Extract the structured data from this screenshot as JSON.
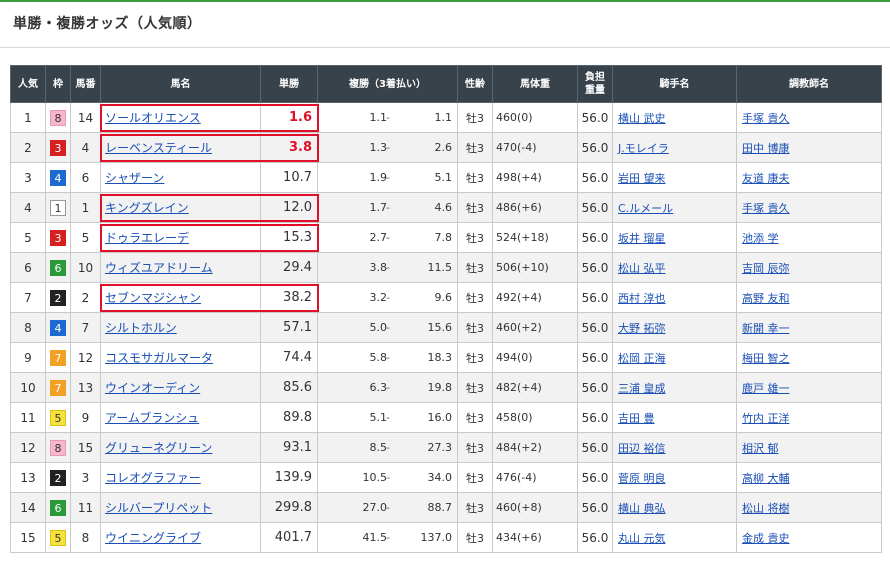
{
  "page": {
    "title": "単勝・複勝オッズ（人気順）"
  },
  "table": {
    "headers": [
      "人気",
      "枠",
      "馬番",
      "馬名",
      "単勝",
      "複勝（3着払い）",
      "性齢",
      "馬体重",
      "負担重量",
      "騎手名",
      "調教師名"
    ],
    "rows": [
      {
        "pop": "1",
        "waku": "8",
        "num": "14",
        "horse": "ソールオリエンス",
        "win": "1.6",
        "plo": "1.1",
        "phi": "1.1",
        "sex": "牡3",
        "weight": "460(0)",
        "kg": "56.0",
        "jockey": "横山 武史",
        "trainer": "手塚 貴久",
        "hot": true
      },
      {
        "pop": "2",
        "waku": "3",
        "num": "4",
        "horse": "レーベンスティール",
        "win": "3.8",
        "plo": "1.3",
        "phi": "2.6",
        "sex": "牡3",
        "weight": "470(-4)",
        "kg": "56.0",
        "jockey": "J.モレイラ",
        "trainer": "田中 博康",
        "hot": true
      },
      {
        "pop": "3",
        "waku": "4",
        "num": "6",
        "horse": "シャザーン",
        "win": "10.7",
        "plo": "1.9",
        "phi": "5.1",
        "sex": "牡3",
        "weight": "498(+4)",
        "kg": "56.0",
        "jockey": "岩田 望来",
        "trainer": "友道 康夫",
        "hot": false
      },
      {
        "pop": "4",
        "waku": "1",
        "num": "1",
        "horse": "キングズレイン",
        "win": "12.0",
        "plo": "1.7",
        "phi": "4.6",
        "sex": "牡3",
        "weight": "486(+6)",
        "kg": "56.0",
        "jockey": "C.ルメール",
        "trainer": "手塚 貴久",
        "hot": false
      },
      {
        "pop": "5",
        "waku": "3",
        "num": "5",
        "horse": "ドゥラエレーデ",
        "win": "15.3",
        "plo": "2.7",
        "phi": "7.8",
        "sex": "牡3",
        "weight": "524(+18)",
        "kg": "56.0",
        "jockey": "坂井 瑠星",
        "trainer": "池添 学",
        "hot": false
      },
      {
        "pop": "6",
        "waku": "6",
        "num": "10",
        "horse": "ウィズユアドリーム",
        "win": "29.4",
        "plo": "3.8",
        "phi": "11.5",
        "sex": "牡3",
        "weight": "506(+10)",
        "kg": "56.0",
        "jockey": "松山 弘平",
        "trainer": "吉岡 辰弥",
        "hot": false
      },
      {
        "pop": "7",
        "waku": "2",
        "num": "2",
        "horse": "セブンマジシャン",
        "win": "38.2",
        "plo": "3.2",
        "phi": "9.6",
        "sex": "牡3",
        "weight": "492(+4)",
        "kg": "56.0",
        "jockey": "西村 淳也",
        "trainer": "高野 友和",
        "hot": false
      },
      {
        "pop": "8",
        "waku": "4",
        "num": "7",
        "horse": "シルトホルン",
        "win": "57.1",
        "plo": "5.0",
        "phi": "15.6",
        "sex": "牡3",
        "weight": "460(+2)",
        "kg": "56.0",
        "jockey": "大野 拓弥",
        "trainer": "新開 幸一",
        "hot": false
      },
      {
        "pop": "9",
        "waku": "7",
        "num": "12",
        "horse": "コスモサガルマータ",
        "win": "74.4",
        "plo": "5.8",
        "phi": "18.3",
        "sex": "牡3",
        "weight": "494(0)",
        "kg": "56.0",
        "jockey": "松岡 正海",
        "trainer": "梅田 智之",
        "hot": false
      },
      {
        "pop": "10",
        "waku": "7",
        "num": "13",
        "horse": "ウインオーディン",
        "win": "85.6",
        "plo": "6.3",
        "phi": "19.8",
        "sex": "牡3",
        "weight": "482(+4)",
        "kg": "56.0",
        "jockey": "三浦 皇成",
        "trainer": "鹿戸 雄一",
        "hot": false
      },
      {
        "pop": "11",
        "waku": "5",
        "num": "9",
        "horse": "アームブランシュ",
        "win": "89.8",
        "plo": "5.1",
        "phi": "16.0",
        "sex": "牡3",
        "weight": "458(0)",
        "kg": "56.0",
        "jockey": "吉田 豊",
        "trainer": "竹内 正洋",
        "hot": false
      },
      {
        "pop": "12",
        "waku": "8",
        "num": "15",
        "horse": "グリューネグリーン",
        "win": "93.1",
        "plo": "8.5",
        "phi": "27.3",
        "sex": "牡3",
        "weight": "484(+2)",
        "kg": "56.0",
        "jockey": "田辺 裕信",
        "trainer": "相沢 郁",
        "hot": false
      },
      {
        "pop": "13",
        "waku": "2",
        "num": "3",
        "horse": "コレオグラファー",
        "win": "139.9",
        "plo": "10.5",
        "phi": "34.0",
        "sex": "牡3",
        "weight": "476(-4)",
        "kg": "56.0",
        "jockey": "菅原 明良",
        "trainer": "高柳 大輔",
        "hot": false
      },
      {
        "pop": "14",
        "waku": "6",
        "num": "11",
        "horse": "シルバープリペット",
        "win": "299.8",
        "plo": "27.0",
        "phi": "88.7",
        "sex": "牡3",
        "weight": "460(+8)",
        "kg": "56.0",
        "jockey": "横山 典弘",
        "trainer": "松山 将樹",
        "hot": false
      },
      {
        "pop": "15",
        "waku": "5",
        "num": "8",
        "horse": "ウイニングライブ",
        "win": "401.7",
        "plo": "41.5",
        "phi": "137.0",
        "sex": "牡3",
        "weight": "434(+6)",
        "kg": "56.0",
        "jockey": "丸山 元気",
        "trainer": "金成 貴史",
        "hot": false
      }
    ]
  },
  "waku_colors": {
    "1": {
      "bg": "#ffffff",
      "fg": "#333333",
      "border": "#999999"
    },
    "2": {
      "bg": "#222222",
      "fg": "#ffffff",
      "border": "#222222"
    },
    "3": {
      "bg": "#d52020",
      "fg": "#ffffff",
      "border": "#d52020"
    },
    "4": {
      "bg": "#1d6bd1",
      "fg": "#ffffff",
      "border": "#1d6bd1"
    },
    "5": {
      "bg": "#f6e23a",
      "fg": "#333333",
      "border": "#d6c21a"
    },
    "6": {
      "bg": "#2b9a39",
      "fg": "#ffffff",
      "border": "#2b9a39"
    },
    "7": {
      "bg": "#f3a126",
      "fg": "#ffffff",
      "border": "#f3a126"
    },
    "8": {
      "bg": "#f7b6cb",
      "fg": "#333333",
      "border": "#e59ab3"
    }
  },
  "highlight_color": "#e0102a"
}
